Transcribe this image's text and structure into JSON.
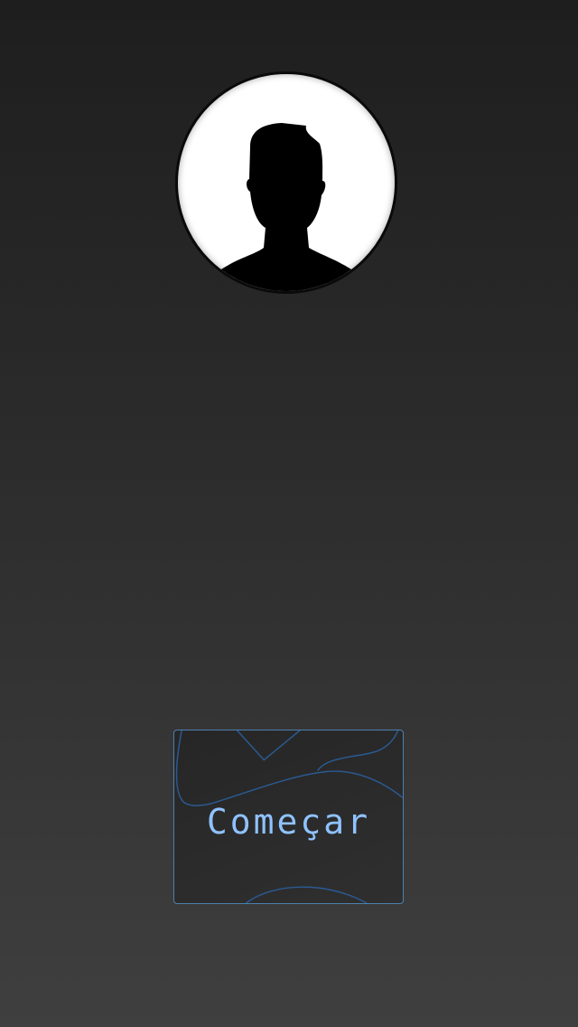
{
  "profile": {
    "avatar_icon": "person-silhouette-icon"
  },
  "start": {
    "label": "Começar",
    "accent_color": "#8fc2ff",
    "border_color": "#4d80ad"
  }
}
